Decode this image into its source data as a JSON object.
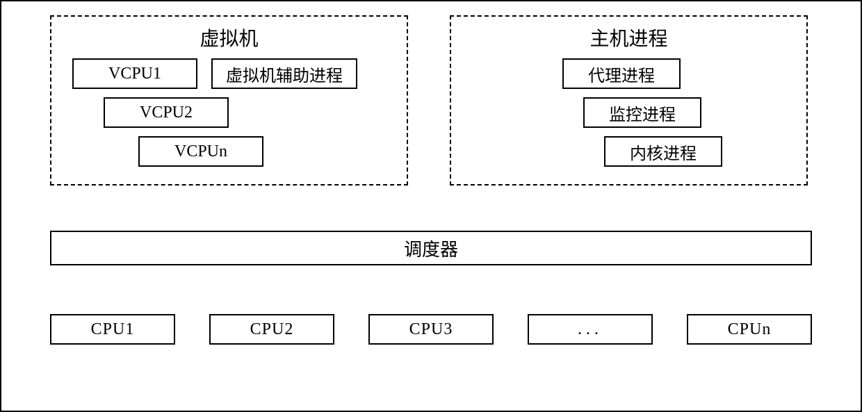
{
  "vm": {
    "title": "虚拟机",
    "vcpu1": "VCPU1",
    "vcpu2": "VCPU2",
    "vcpun": "VCPUn",
    "helper": "虚拟机辅助进程"
  },
  "host": {
    "title": "主机进程",
    "proxy": "代理进程",
    "monitor": "监控进程",
    "kernel": "内核进程"
  },
  "scheduler": "调度器",
  "cpus": {
    "cpu1": "CPU1",
    "cpu2": "CPU2",
    "cpu3": "CPU3",
    "dots": "...",
    "cpun": "CPUn"
  }
}
